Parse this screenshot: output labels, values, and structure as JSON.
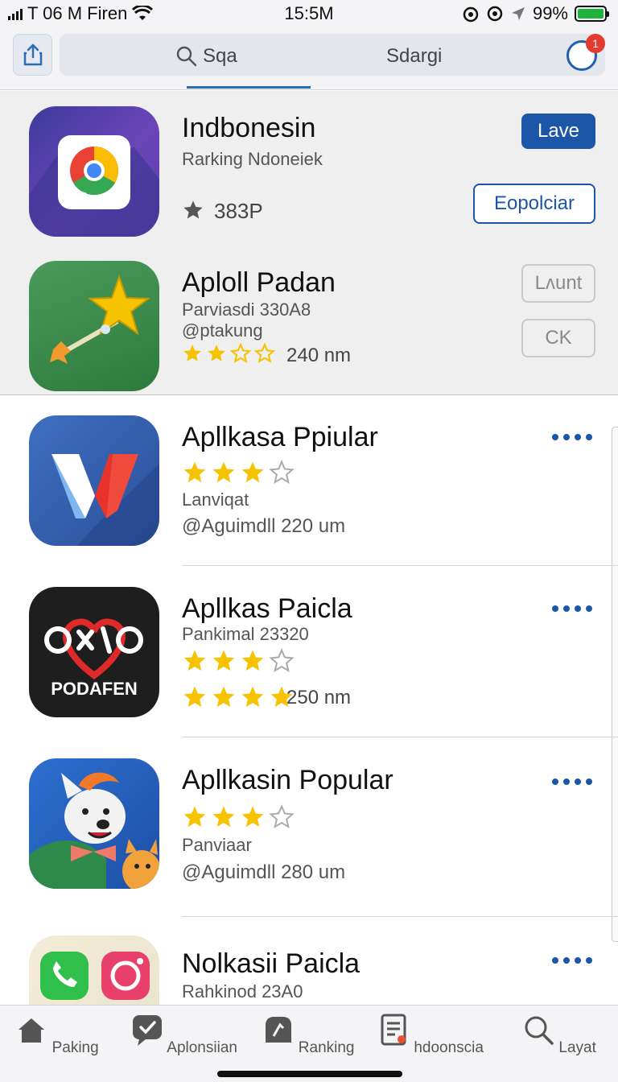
{
  "status_bar": {
    "carrier": "T 06 M Firen",
    "time": "15:5M",
    "battery": "99%",
    "battery_level": 0.99
  },
  "header": {
    "search_text": "Sqa",
    "search_right_text": "Sdargi",
    "notification_count": "1"
  },
  "featured": [
    {
      "title": "Indbonesin",
      "subtitle": "Rarking Ndoneiek",
      "rating_text": "383P",
      "primary_button": "Lave",
      "secondary_button": "Eopolciar",
      "icon": "chrome-like-icon"
    },
    {
      "title": "Aploll Padan",
      "subtitle": "Parviasdi 330A8",
      "meta": "@ptakung",
      "rating_stars": 2.5,
      "rating_text": "240 nm",
      "button1": "Lʌunt",
      "button2": "CK",
      "icon": "star-wand-icon"
    }
  ],
  "apps": [
    {
      "title": "Apllkasa Ppiular",
      "stars": 3,
      "line1": "Lanviqat",
      "line2": "@Aguimdll 220 um",
      "icon": "w-logo-icon"
    },
    {
      "title": "Apllkas Paicla",
      "line1": "Pankimal 23320",
      "stars": 3,
      "stars2": 4,
      "rating_text": "250 nm",
      "icon_label": "PODAFEN",
      "icon": "podafen-heart-icon"
    },
    {
      "title": "Apllkasin Popular",
      "stars": 3,
      "line1": "Panviaar",
      "line2": "@Aguimdll 280 um",
      "icon": "dog-cartoon-icon"
    },
    {
      "title": "Nolkasii Paicla",
      "line1": "Rahkinod 23A0",
      "icon": "whatsapp-instagram-icon"
    }
  ],
  "tabs": [
    {
      "label": "Paking",
      "icon": "home-icon"
    },
    {
      "label": "Aplonsiian",
      "icon": "chat-check-icon"
    },
    {
      "label": "Ranking",
      "icon": "ranking-icon"
    },
    {
      "label": "hdoonscia",
      "icon": "document-icon"
    },
    {
      "label": "Layat",
      "icon": "search-icon"
    }
  ],
  "colors": {
    "accent": "#1c56a8",
    "star": "#f6c300",
    "notification": "#e53a2e",
    "battery": "#1fb33c"
  }
}
